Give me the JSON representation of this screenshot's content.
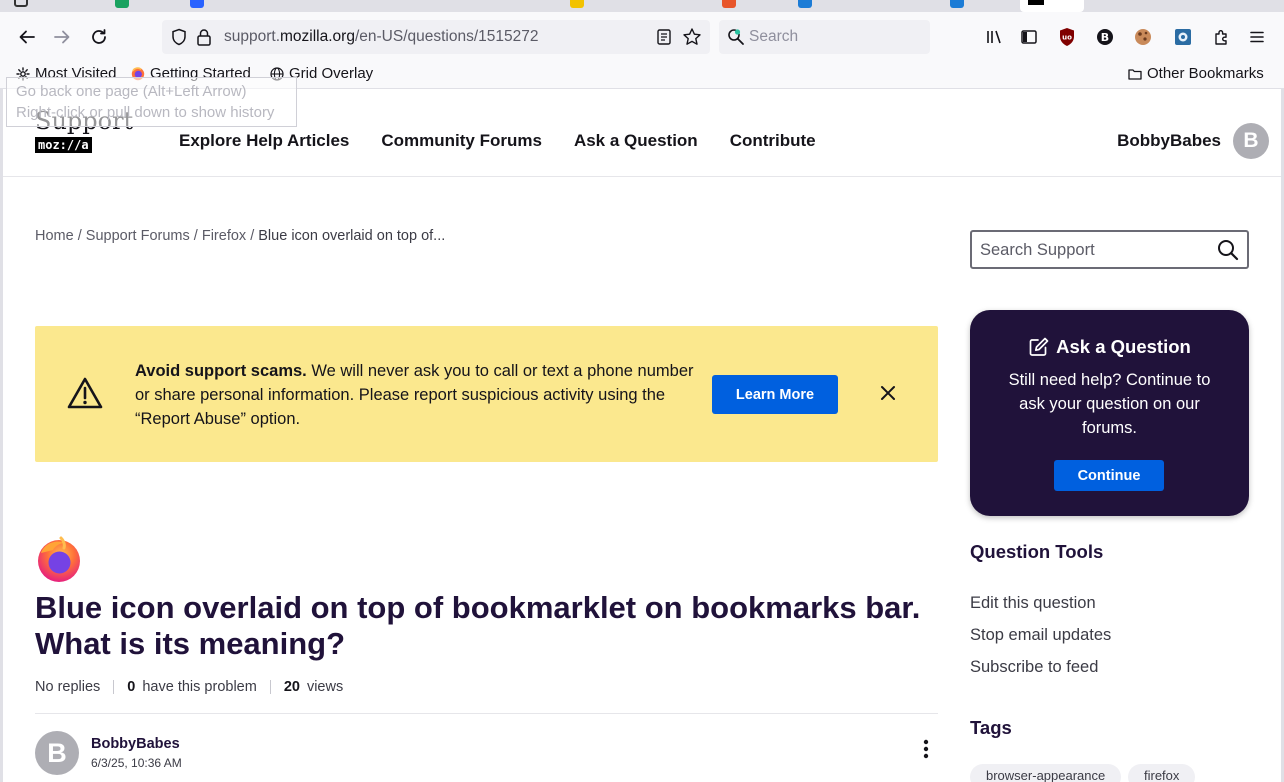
{
  "browser": {
    "url_prefix": "support.",
    "url_domain": "mozilla.org",
    "url_path": "/en-US/questions/1515272",
    "search_placeholder": "Search",
    "tooltip_line1": "Go back one page (Alt+Left Arrow)",
    "tooltip_line2": "Right-click or pull down to show history",
    "bookmarks": [
      {
        "label": "Most Visited",
        "icon": "gear-icon"
      },
      {
        "label": "Getting Started",
        "icon": "firefox-icon"
      },
      {
        "label": "Grid Overlay",
        "icon": "globe-icon"
      }
    ],
    "other_bookmarks": "Other Bookmarks"
  },
  "header": {
    "logo_word": "Support",
    "logo_brand": "moz://a",
    "nav": [
      "Explore Help Articles",
      "Community Forums",
      "Ask a Question",
      "Contribute"
    ],
    "username": "BobbyBabes",
    "avatar_letter": "B"
  },
  "breadcrumb": {
    "home": "Home",
    "forums": "Support Forums",
    "product": "Firefox",
    "current": "Blue icon overlaid on top of...",
    "sep": "/"
  },
  "search": {
    "placeholder": "Search Support"
  },
  "banner": {
    "bold": "Avoid support scams.",
    "text": " We will never ask you to call or text a phone number or share personal information. Please report suspicious activity using the “Report Abuse” option.",
    "button": "Learn More"
  },
  "ask_card": {
    "title": "Ask a Question",
    "text": "Still need help? Continue to ask your question on our forums.",
    "button": "Continue"
  },
  "question_tools": {
    "title": "Question Tools",
    "items": [
      "Edit this question",
      "Stop email updates",
      "Subscribe to feed"
    ]
  },
  "tags": {
    "title": "Tags",
    "items": [
      "browser-appearance",
      "firefox"
    ]
  },
  "question": {
    "title": "Blue icon overlaid on top of bookmarklet on bookmarks bar. What is its meaning?",
    "replies": "No replies",
    "problem_count": "0",
    "problem_label": "have this problem",
    "views_count": "20",
    "views_label": "views"
  },
  "post": {
    "author": "BobbyBabes",
    "avatar_letter": "B",
    "date": "6/3/25, 10:36 AM"
  },
  "colors": {
    "accent": "#0060df",
    "banner": "#fbe88e",
    "card": "#20123a"
  }
}
